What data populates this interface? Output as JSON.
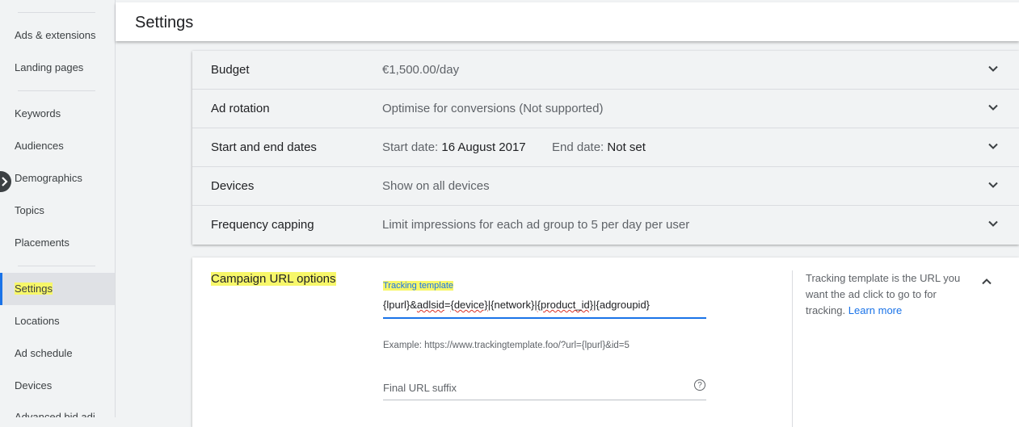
{
  "sidebar": {
    "items": [
      {
        "label": "Ads & extensions"
      },
      {
        "label": "Landing pages"
      },
      {
        "label": "Keywords"
      },
      {
        "label": "Audiences"
      },
      {
        "label": "Demographics"
      },
      {
        "label": "Topics"
      },
      {
        "label": "Placements"
      },
      {
        "label": "Settings",
        "active": true
      },
      {
        "label": "Locations"
      },
      {
        "label": "Ad schedule"
      },
      {
        "label": "Devices"
      },
      {
        "label": "Advanced bid adj"
      }
    ]
  },
  "header": {
    "title": "Settings"
  },
  "settings_rows": [
    {
      "label": "Budget",
      "value": "€1,500.00/day"
    },
    {
      "label": "Ad rotation",
      "value": "Optimise for conversions (Not supported)"
    },
    {
      "label": "Start and end dates",
      "start_label": "Start date:",
      "start_value": "16 August 2017",
      "end_label": "End date:",
      "end_value": "Not set"
    },
    {
      "label": "Devices",
      "value": "Show on all devices"
    },
    {
      "label": "Frequency capping",
      "value": "Limit impressions for each ad group to 5 per day per user"
    }
  ],
  "url_options": {
    "title": "Campaign URL options",
    "tracking_label": "Tracking template",
    "tracking_value_parts": [
      "{lpurl}&",
      "adlsid",
      "=",
      "{device}",
      "|{network}|",
      "{product_id}",
      "|{adgroupid}"
    ],
    "example": "Example: https://www.trackingtemplate.foo/?url={lpurl}&id=5",
    "suffix_label": "Final URL suffix",
    "help_icon": "?",
    "help_text": "Tracking template is the URL you want the ad click to go to for tracking.",
    "learn_more": "Learn more"
  },
  "icons": {
    "collapse": "chevron-right-icon",
    "expand": "chevron-down-icon",
    "collapse_section": "chevron-up-icon"
  },
  "colors": {
    "accent": "#1a73e8",
    "highlight": "#f7f76a"
  }
}
